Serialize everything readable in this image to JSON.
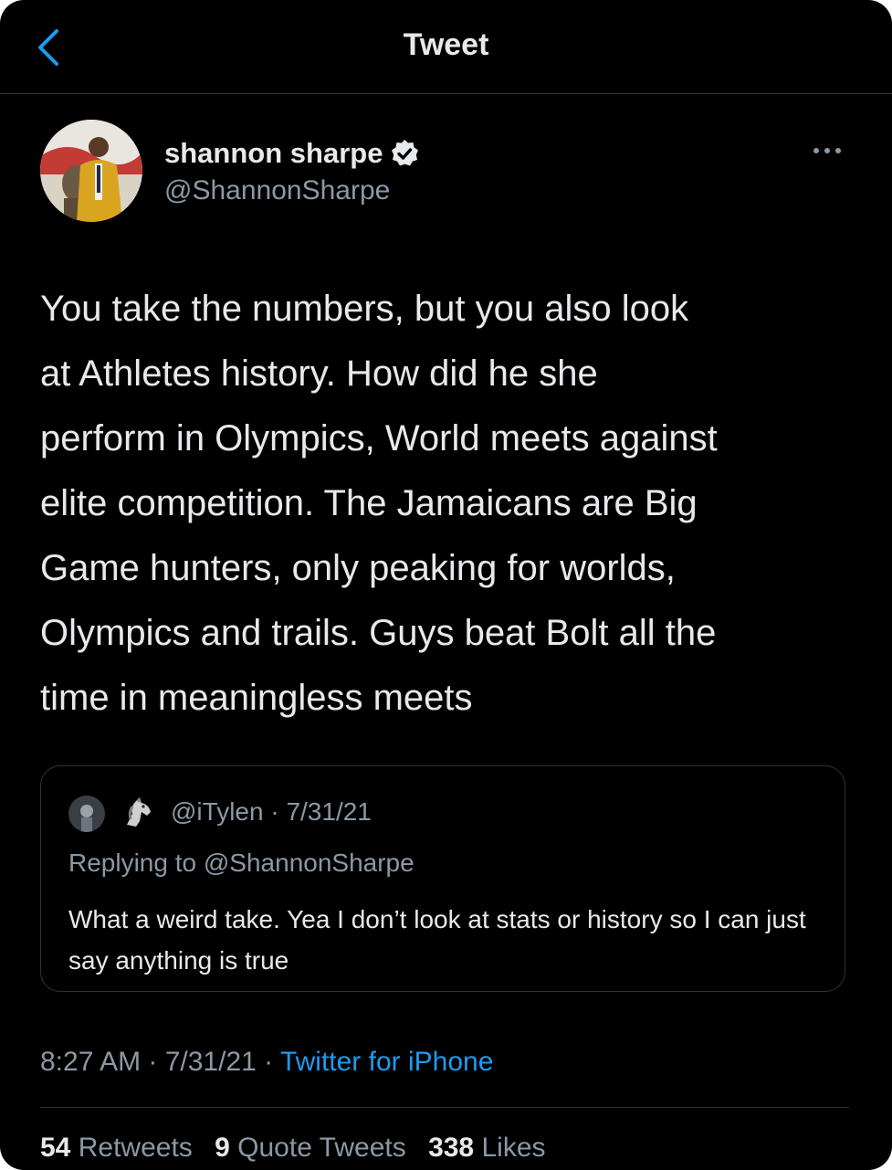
{
  "header": {
    "title": "Tweet",
    "back_icon": "chevron-left-icon"
  },
  "author": {
    "display_name": "shannon sharpe",
    "handle": "@ShannonSharpe",
    "verified_icon": "verified-badge-icon"
  },
  "more_icon": "more-horizontal-icon",
  "tweet": {
    "text": "You take the numbers, but you also look\nat Athletes history. How did he she\nperform in Olympics, World meets against\nelite competition. The Jamaicans are Big\nGame hunters, only peaking for worlds,\nOlympics and trails. Guys beat Bolt all the\ntime in meaningless meets"
  },
  "quote": {
    "emoji_icon": "horse-emoji-icon",
    "meta": "@iTylen · 7/31/21",
    "replying_prefix": "Replying to ",
    "replying_handle": "@ShannonSharpe",
    "text": "What a weird take. Yea I don’t look at stats or history so I can just say anything is true"
  },
  "timestamp": {
    "time_date": "8:27 AM · 7/31/21 · ",
    "source": "Twitter for iPhone"
  },
  "stats": {
    "retweets_count": "54",
    "retweets_label": "Retweets",
    "quotes_count": "9",
    "quotes_label": "Quote Tweets",
    "likes_count": "338",
    "likes_label": "Likes"
  },
  "colors": {
    "background": "#000000",
    "text": "#e7e9ea",
    "secondary_text": "#8b98a5",
    "accent": "#1d9bf0",
    "border": "#2f3336"
  }
}
